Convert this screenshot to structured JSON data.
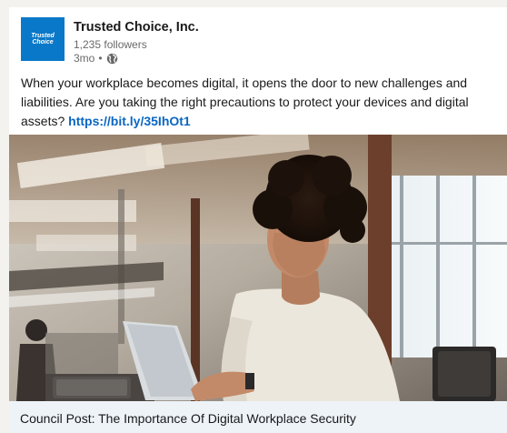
{
  "post": {
    "company_name": "Trusted Choice, Inc.",
    "followers": "1,235 followers",
    "age": "3mo",
    "dot": "•",
    "visibility_icon": "globe-icon",
    "logo_line_1": "Trusted",
    "logo_line_2": "Choice",
    "body_text": "When your workplace becomes digital, it opens the door to new challenges and liabilities. Are you taking the right precautions to protect your devices and digital assets? ",
    "link_text": "https://bit.ly/35IhOt1"
  },
  "article": {
    "title": "Council Post: The Importance Of Digital Workplace Security"
  },
  "colors": {
    "brand_blue": "#0a78c8",
    "link_blue": "#0a66c2",
    "article_bar": "#eef3f8"
  }
}
